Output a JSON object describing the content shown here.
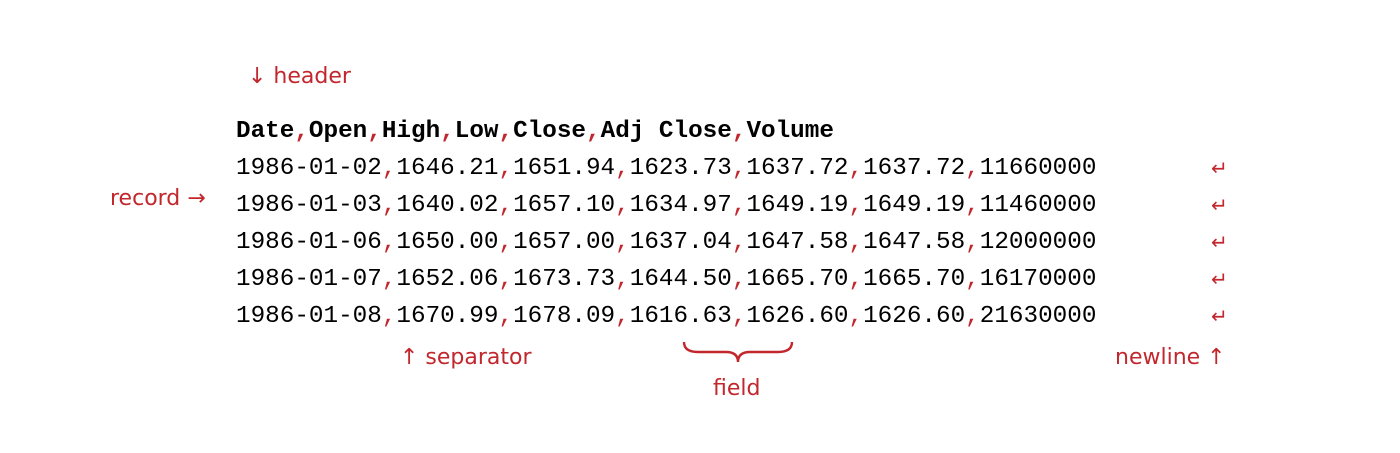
{
  "annotations": {
    "header": "↓ header",
    "record": "record →",
    "separator": "↑ separator",
    "field": "field",
    "newline": "newline ↑",
    "newline_glyph": "↵"
  },
  "csv": {
    "separator": ",",
    "header": [
      "Date",
      "Open",
      "High",
      "Low",
      "Close",
      "Adj Close",
      "Volume"
    ],
    "rows": [
      [
        "1986-01-02",
        "1646.21",
        "1651.94",
        "1623.73",
        "1637.72",
        "1637.72",
        "11660000"
      ],
      [
        "1986-01-03",
        "1640.02",
        "1657.10",
        "1634.97",
        "1649.19",
        "1649.19",
        "11460000"
      ],
      [
        "1986-01-06",
        "1650.00",
        "1657.00",
        "1637.04",
        "1647.58",
        "1647.58",
        "12000000"
      ],
      [
        "1986-01-07",
        "1652.06",
        "1673.73",
        "1644.50",
        "1665.70",
        "1665.70",
        "16170000"
      ],
      [
        "1986-01-08",
        "1670.99",
        "1678.09",
        "1616.63",
        "1626.60",
        "1626.60",
        "21630000"
      ]
    ]
  },
  "colors": {
    "accent": "#c1272d",
    "text": "#000000"
  }
}
